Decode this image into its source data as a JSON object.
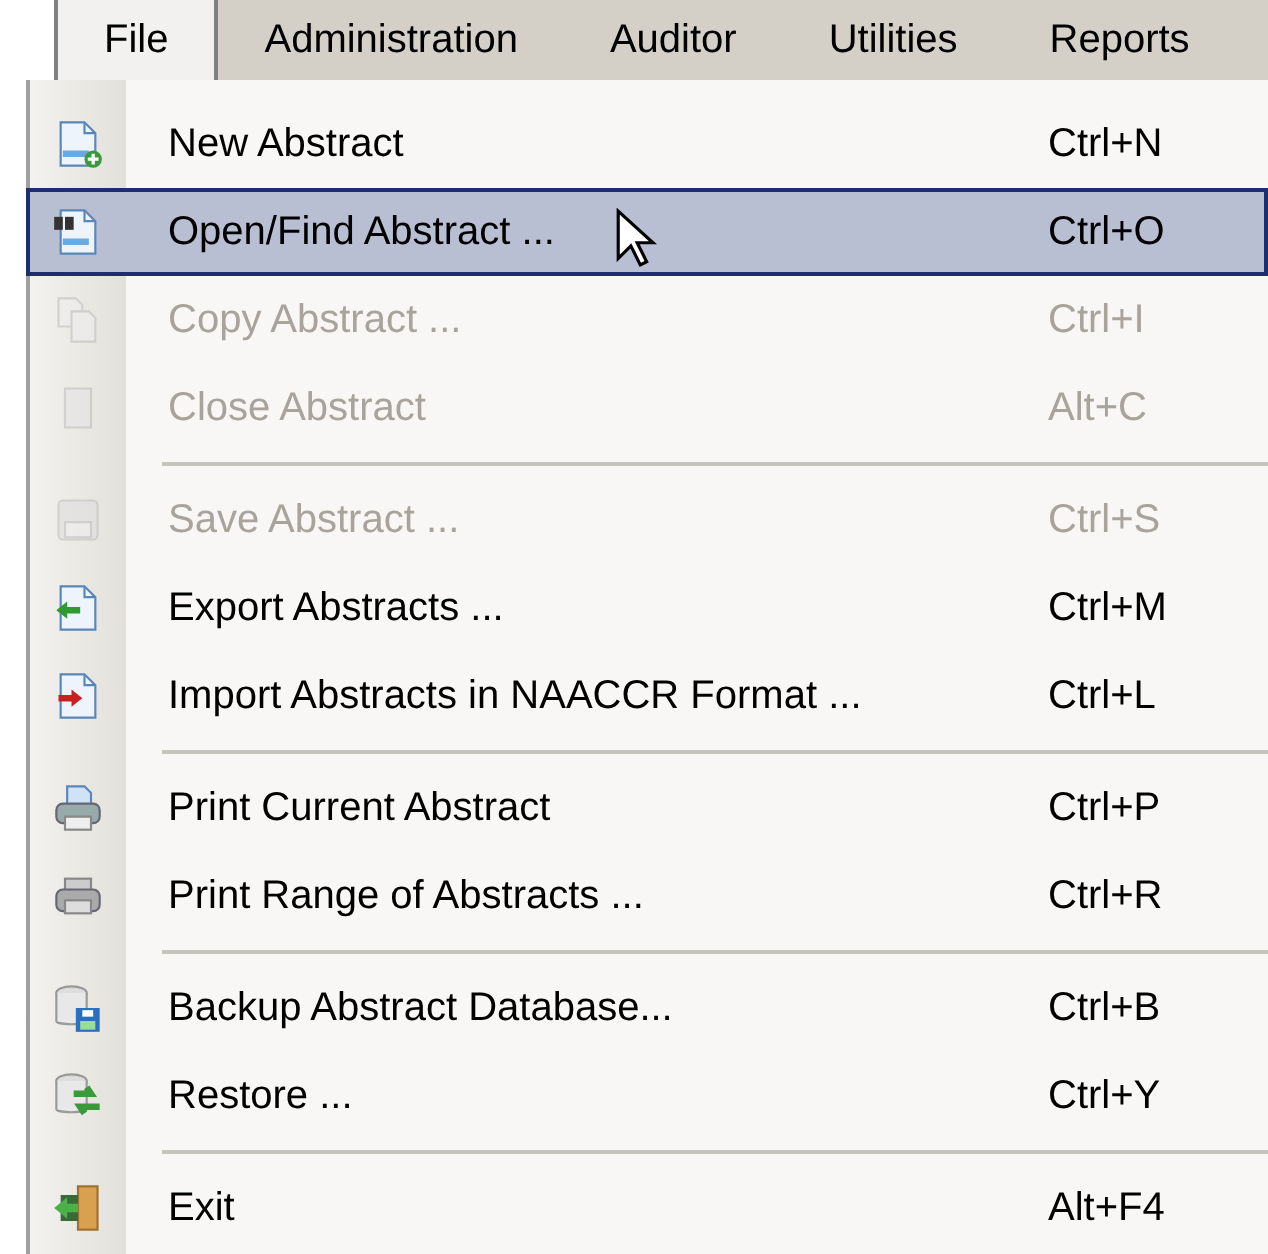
{
  "menu_bar": [
    {
      "label": "File",
      "selected": true
    },
    {
      "label": "Administration",
      "selected": false
    },
    {
      "label": "Auditor",
      "selected": false
    },
    {
      "label": "Utilities",
      "selected": false
    },
    {
      "label": "Reports",
      "selected": false
    }
  ],
  "file_menu": [
    {
      "kind": "item",
      "label": "New Abstract",
      "shortcut": "Ctrl+N",
      "disabled": false,
      "selected": false
    },
    {
      "kind": "item",
      "label": "Open/Find Abstract ...",
      "shortcut": "Ctrl+O",
      "disabled": false,
      "selected": true
    },
    {
      "kind": "item",
      "label": "Copy Abstract ...",
      "shortcut": "Ctrl+I",
      "disabled": true,
      "selected": false
    },
    {
      "kind": "item",
      "label": "Close Abstract",
      "shortcut": "Alt+C",
      "disabled": true,
      "selected": false
    },
    {
      "kind": "separator"
    },
    {
      "kind": "item",
      "label": "Save Abstract ...",
      "shortcut": "Ctrl+S",
      "disabled": true,
      "selected": false
    },
    {
      "kind": "item",
      "label": "Export Abstracts ...",
      "shortcut": "Ctrl+M",
      "disabled": false,
      "selected": false
    },
    {
      "kind": "item",
      "label": "Import Abstracts in NAACCR Format ...",
      "shortcut": "Ctrl+L",
      "disabled": false,
      "selected": false
    },
    {
      "kind": "separator"
    },
    {
      "kind": "item",
      "label": "Print Current Abstract",
      "shortcut": "Ctrl+P",
      "disabled": false,
      "selected": false
    },
    {
      "kind": "item",
      "label": "Print Range of Abstracts ...",
      "shortcut": "Ctrl+R",
      "disabled": false,
      "selected": false
    },
    {
      "kind": "separator"
    },
    {
      "kind": "item",
      "label": "Backup Abstract Database...",
      "shortcut": "Ctrl+B",
      "disabled": false,
      "selected": false
    },
    {
      "kind": "item",
      "label": "Restore ...",
      "shortcut": "Ctrl+Y",
      "disabled": false,
      "selected": false
    },
    {
      "kind": "separator"
    },
    {
      "kind": "item",
      "label": "Exit",
      "shortcut": "Alt+F4",
      "disabled": false,
      "selected": false
    }
  ]
}
